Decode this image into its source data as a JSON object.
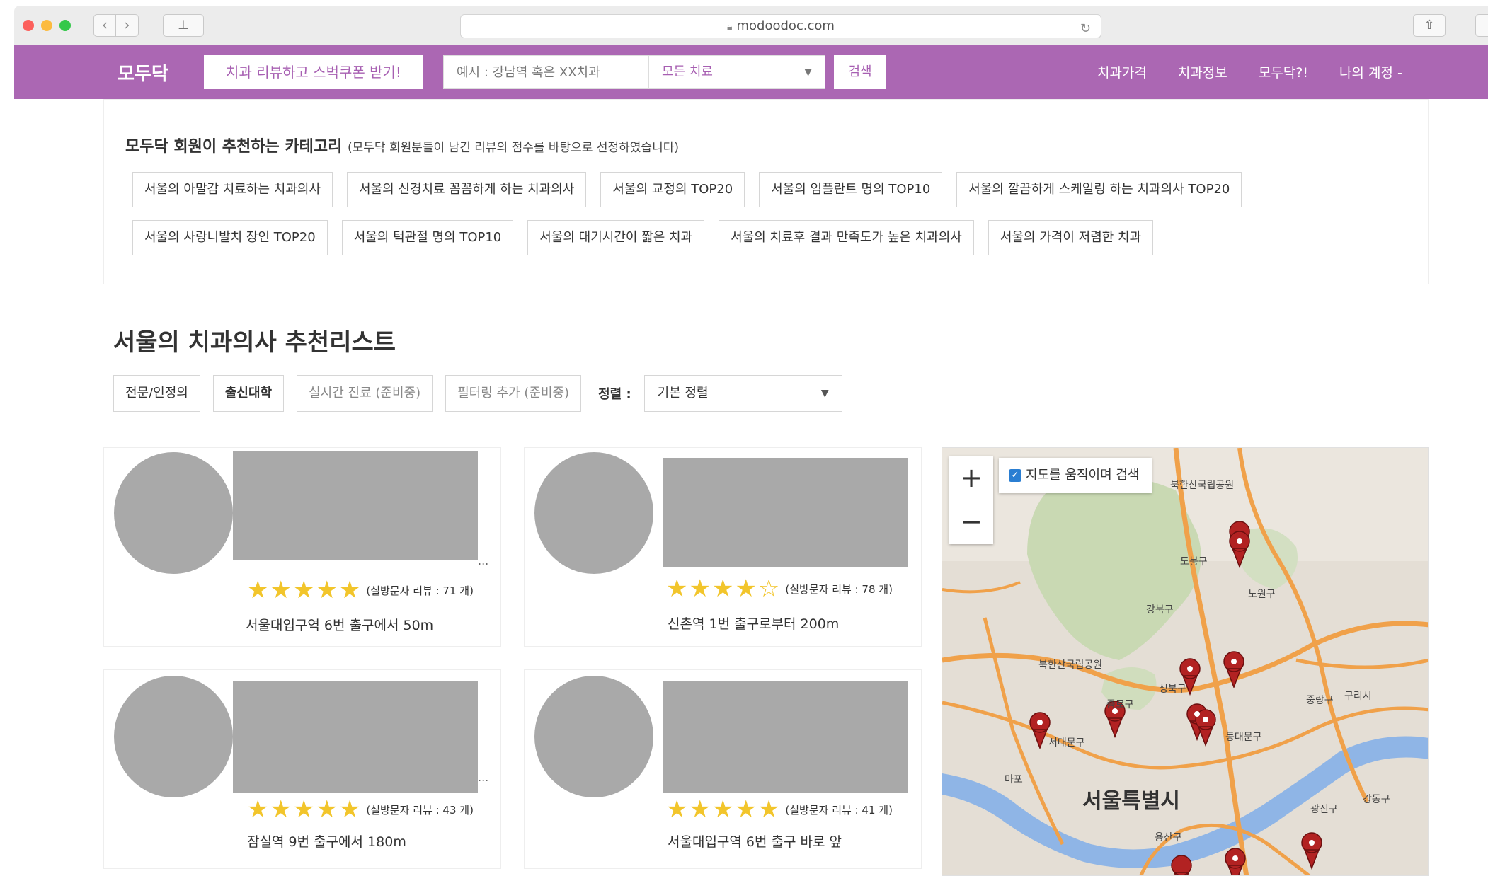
{
  "browser": {
    "url": "modoodoc.com"
  },
  "header": {
    "logo": "모두닥",
    "promo_button": "치과 리뷰하고 스벅쿠폰 받기!",
    "search_placeholder": "예시 : 강남역 혹은 XX치과",
    "treatment_select": "모든 치료",
    "search_button": "검색",
    "nav": [
      "치과가격",
      "치과정보",
      "모두닥?!",
      "나의 계정 -"
    ]
  },
  "categories": {
    "title": "모두닥 회원이 추천하는 카테고리",
    "subtitle": "(모두닥 회원분들이 남긴 리뷰의 점수를 바탕으로 선정하였습니다)",
    "row1": [
      "서울의 아말감 치료하는 치과의사",
      "서울의 신경치료 꼼꼼하게 하는 치과의사",
      "서울의 교정의 TOP20",
      "서울의 임플란트 명의 TOP10",
      "서울의 깔끔하게 스케일링 하는 치과의사 TOP20"
    ],
    "row2": [
      "서울의 사랑니발치 장인 TOP20",
      "서울의 턱관절 명의 TOP10",
      "서울의 대기시간이 짧은 치과",
      "서울의 치료후 결과 만족도가 높은 치과의사",
      "서울의 가격이 저렴한 치과"
    ]
  },
  "list": {
    "title": "서울의 치과의사 추천리스트",
    "filters": [
      "전문/인정의",
      "출신대학",
      "실시간 진료 (준비중)",
      "필터링 추가 (준비중)"
    ],
    "sort_label": "정렬 :",
    "sort_value": "기본 정렬"
  },
  "cards": [
    {
      "stars": "★★★★",
      "half": "★",
      "reviews": "(실방문자 리뷰 : 71 개)",
      "subway": "서울대입구역 6번 출구에서 50m",
      "ellipsis": "..."
    },
    {
      "stars": "★★★★",
      "half": "☆",
      "reviews": "(실방문자 리뷰 : 78 개)",
      "subway": "신촌역 1번 출구로부터 200m",
      "ellipsis": ""
    },
    {
      "stars": "★★★★★",
      "half": "",
      "reviews": "(실방문자 리뷰 : 43 개)",
      "subway": "잠실역 9번 출구에서 180m",
      "ellipsis": "..."
    },
    {
      "stars": "★★★★★",
      "half": "",
      "reviews": "(실방문자 리뷰 : 41 개)",
      "subway": "서울대입구역 6번 출구 바로 앞",
      "ellipsis": ""
    }
  ],
  "map": {
    "zoom_in": "+",
    "zoom_out": "−",
    "move_search_label": "지도를 움직이며 검색",
    "city_label": "서울특별시",
    "labels": [
      "북한산국립공원",
      "도봉구",
      "노원구",
      "강북구",
      "북한산국립공원",
      "성북구",
      "종로구",
      "중랑구",
      "구리시",
      "서대문구",
      "동대문구",
      "마포",
      "광진구",
      "용산구",
      "강동구"
    ],
    "colors": {
      "road": "#f0a14a",
      "river": "#8fb5e6",
      "park": "#c9d9b3"
    }
  },
  "colors": {
    "brand": "#ab67b3",
    "star": "#f2c52b"
  }
}
